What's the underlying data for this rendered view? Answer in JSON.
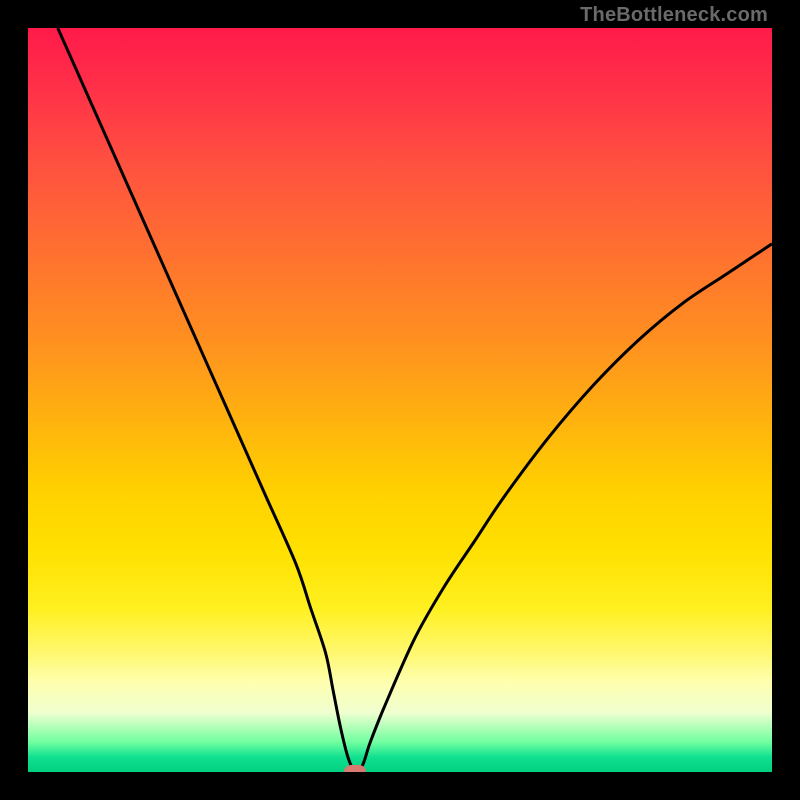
{
  "watermark": "TheBottleneck.com",
  "colors": {
    "frame": "#000000",
    "curve": "#000000",
    "marker": "#d87a70"
  },
  "chart_data": {
    "type": "line",
    "title": "",
    "xlabel": "",
    "ylabel": "",
    "xlim": [
      0,
      100
    ],
    "ylim": [
      0,
      100
    ],
    "x": [
      4,
      8,
      12,
      16,
      20,
      24,
      28,
      32,
      36,
      38,
      40,
      41,
      42,
      43,
      44,
      45,
      46,
      48,
      52,
      56,
      60,
      64,
      70,
      76,
      82,
      88,
      94,
      100
    ],
    "values": [
      100,
      91,
      82,
      73,
      64,
      55,
      46,
      37,
      28,
      22,
      16,
      11,
      6,
      2,
      0,
      1,
      4,
      9,
      18,
      25,
      31,
      37,
      45,
      52,
      58,
      63,
      67,
      71
    ],
    "marker": {
      "x": 44,
      "y": 0
    },
    "annotations": []
  }
}
